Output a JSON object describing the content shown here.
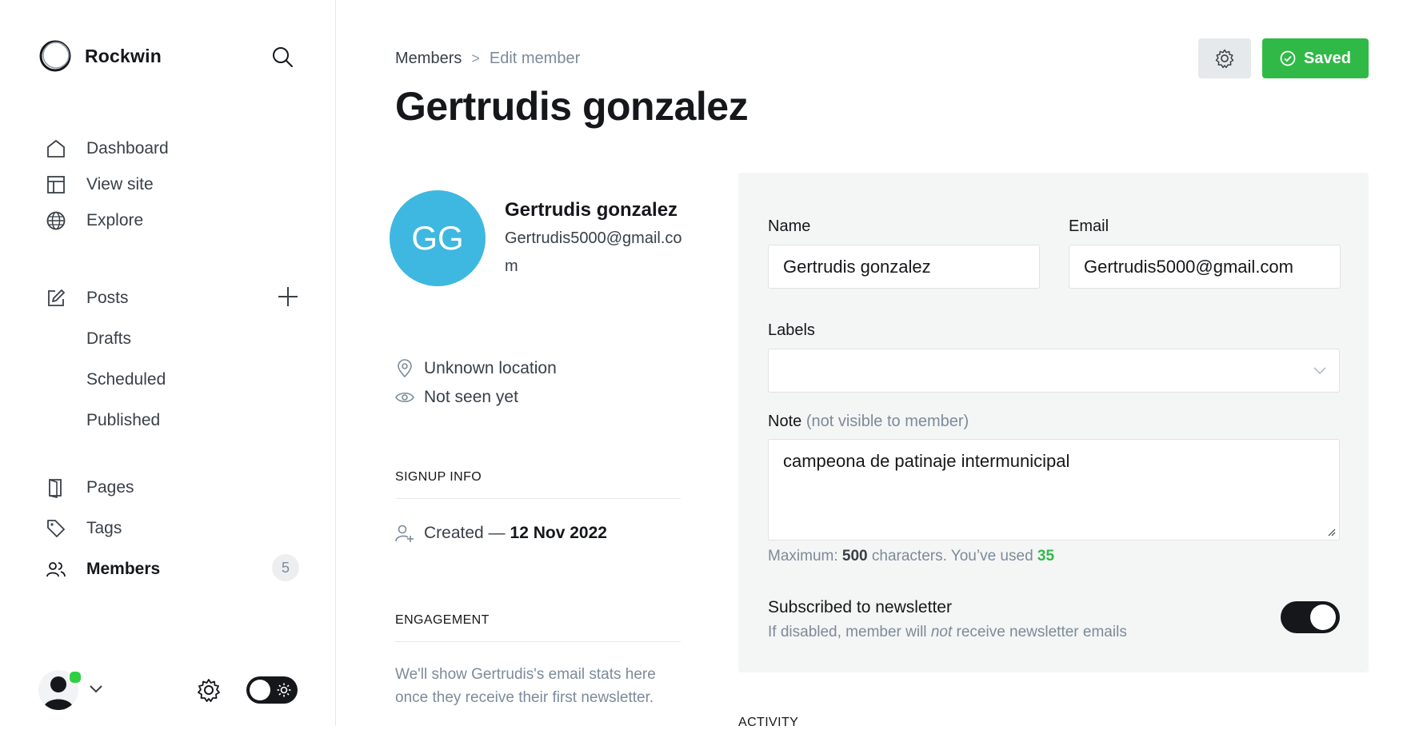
{
  "brand": {
    "name": "Rockwin"
  },
  "sidebar": {
    "items": [
      {
        "label": "Dashboard",
        "icon": "home-icon"
      },
      {
        "label": "View site",
        "icon": "layout-icon"
      },
      {
        "label": "Explore",
        "icon": "globe-icon"
      },
      {
        "label": "Posts",
        "icon": "edit-icon"
      },
      {
        "label": "Drafts"
      },
      {
        "label": "Scheduled"
      },
      {
        "label": "Published"
      },
      {
        "label": "Pages",
        "icon": "page-icon"
      },
      {
        "label": "Tags",
        "icon": "tag-icon"
      },
      {
        "label": "Members",
        "icon": "members-icon",
        "count": "5",
        "active": true
      }
    ]
  },
  "breadcrumb": {
    "parent": "Members",
    "separator": ">",
    "current": "Edit member"
  },
  "page": {
    "title": "Gertrudis gonzalez"
  },
  "actions": {
    "saved_label": "Saved"
  },
  "member": {
    "initials": "GG",
    "name": "Gertrudis gonzalez",
    "email": "Gertrudis5000@gmail.com",
    "avatar_color": "#3eb8e0",
    "location": "Unknown location",
    "seen": "Not seen yet",
    "signup_heading": "SIGNUP INFO",
    "created_label": "Created —",
    "created_date": "12 Nov 2022",
    "engagement_heading": "ENGAGEMENT",
    "engagement_text": "We'll show Gertrudis's email stats here once they receive their first newsletter.",
    "activity_heading": "ACTIVITY"
  },
  "form": {
    "name_label": "Name",
    "name_value": "Gertrudis gonzalez",
    "email_label": "Email",
    "email_value": "Gertrudis5000@gmail.com",
    "labels_label": "Labels",
    "labels_value": "",
    "note_label": "Note",
    "note_hint": "(not visible to member)",
    "note_value": "campeona de patinaje intermunicipal",
    "max_prefix": "Maximum:",
    "max_value": "500",
    "max_middle": "characters. You’ve used",
    "used_value": "35",
    "newsletter_title": "Subscribed to newsletter",
    "newsletter_desc_pre": "If disabled, member will",
    "newsletter_desc_em": "not",
    "newsletter_desc_post": "receive newsletter emails",
    "newsletter_subscribed": true
  },
  "colors": {
    "accent_green": "#30b947",
    "online": "#30cf43",
    "text": "#15171a",
    "muted": "#7c8b9a"
  }
}
